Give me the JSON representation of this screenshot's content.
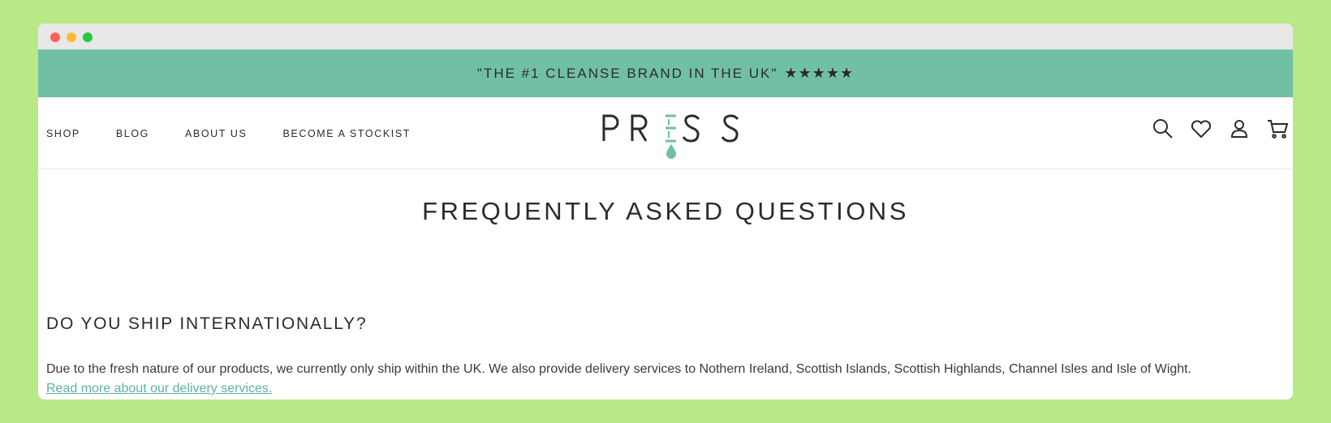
{
  "announcement": {
    "text": "\"THE #1 CLEANSE BRAND IN THE UK\"",
    "stars": "★★★★★"
  },
  "nav": {
    "items": [
      {
        "label": "SHOP"
      },
      {
        "label": "BLOG"
      },
      {
        "label": "ABOUT US"
      },
      {
        "label": "BECOME A STOCKIST"
      }
    ]
  },
  "logo": {
    "text": "PRESS",
    "accent_color": "#72c0a3"
  },
  "header_icons": [
    "search-icon",
    "heart-icon",
    "user-icon",
    "cart-icon"
  ],
  "main": {
    "title": "FREQUENTLY ASKED QUESTIONS",
    "faq": {
      "question": "DO YOU SHIP INTERNATIONALLY?",
      "answer": "Due to the fresh nature of our products, we currently only ship within the UK. We also provide delivery services to Nothern Ireland, Scottish Islands, Scottish Highlands, Channel Isles and Isle of Wight.",
      "link": "Read more about our delivery services."
    }
  },
  "colors": {
    "page_background": "#b9e986",
    "announcement_bar": "#72c0a3",
    "link": "#5db597",
    "text": "#2b2b2b"
  }
}
